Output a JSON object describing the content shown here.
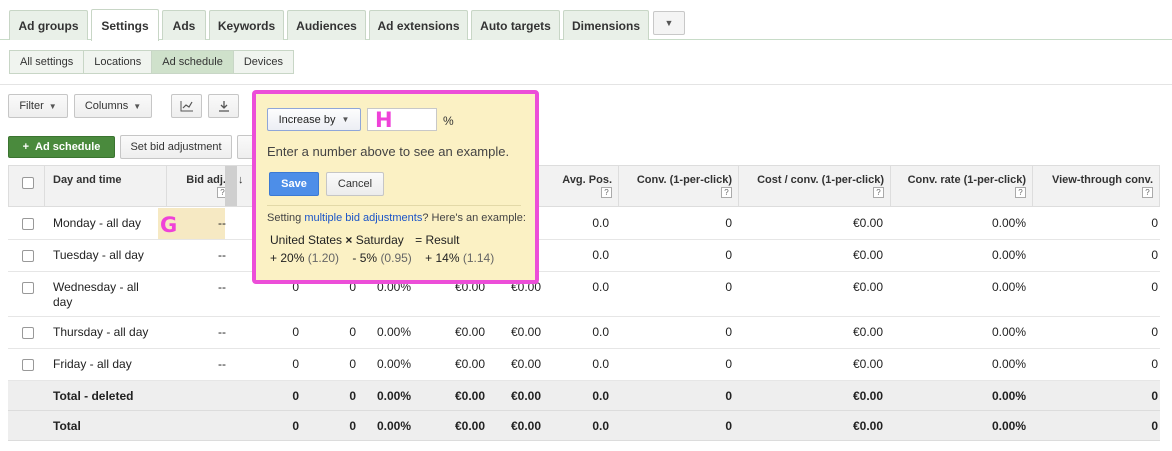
{
  "tabs": [
    "Ad groups",
    "Settings",
    "Ads",
    "Keywords",
    "Audiences",
    "Ad extensions",
    "Auto targets",
    "Dimensions"
  ],
  "tabs_active_index": 1,
  "subtabs": [
    "All settings",
    "Locations",
    "Ad schedule",
    "Devices"
  ],
  "subtabs_active_index": 2,
  "toolbar": {
    "filter": "Filter",
    "columns": "Columns"
  },
  "actions": {
    "add_schedule": "Ad schedule",
    "set_bid": "Set bid adjustment"
  },
  "table": {
    "headers": {
      "day_time": "Day and time",
      "bid_adj": "Bid adj.",
      "avg_pos": "Avg. Pos.",
      "conv": "Conv. (1-per-click)",
      "cost_conv": "Cost / conv. (1-per-click)",
      "conv_rate": "Conv. rate (1-per-click)",
      "view_through": "View-through conv."
    },
    "rows": [
      {
        "day": "Monday - all day",
        "bid": "--",
        "c1": "",
        "c2": "",
        "c3": "",
        "c4": "",
        "c5": "",
        "avg_pos": "0.0",
        "conv": "0",
        "cost_conv": "€0.00",
        "conv_rate": "0.00%",
        "view": "0"
      },
      {
        "day": "Tuesday - all day",
        "bid": "--",
        "c1": "",
        "c2": "",
        "c3": "",
        "c4": "",
        "c5": "",
        "avg_pos": "0.0",
        "conv": "0",
        "cost_conv": "€0.00",
        "conv_rate": "0.00%",
        "view": "0"
      },
      {
        "day": "Wednesday - all day",
        "bid": "--",
        "c1": "0",
        "c2": "0",
        "c3": "0.00%",
        "c4": "€0.00",
        "c5": "€0.00",
        "avg_pos": "0.0",
        "conv": "0",
        "cost_conv": "€0.00",
        "conv_rate": "0.00%",
        "view": "0"
      },
      {
        "day": "Thursday - all day",
        "bid": "--",
        "c1": "0",
        "c2": "0",
        "c3": "0.00%",
        "c4": "€0.00",
        "c5": "€0.00",
        "avg_pos": "0.0",
        "conv": "0",
        "cost_conv": "€0.00",
        "conv_rate": "0.00%",
        "view": "0"
      },
      {
        "day": "Friday - all day",
        "bid": "--",
        "c1": "0",
        "c2": "0",
        "c3": "0.00%",
        "c4": "€0.00",
        "c5": "€0.00",
        "avg_pos": "0.0",
        "conv": "0",
        "cost_conv": "€0.00",
        "conv_rate": "0.00%",
        "view": "0"
      }
    ],
    "totals": [
      {
        "day": "Total - deleted",
        "c1": "0",
        "c2": "0",
        "c3": "0.00%",
        "c4": "€0.00",
        "c5": "€0.00",
        "avg_pos": "0.0",
        "conv": "0",
        "cost_conv": "€0.00",
        "conv_rate": "0.00%",
        "view": "0"
      },
      {
        "day": "Total",
        "c1": "0",
        "c2": "0",
        "c3": "0.00%",
        "c4": "€0.00",
        "c5": "€0.00",
        "avg_pos": "0.0",
        "conv": "0",
        "cost_conv": "€0.00",
        "conv_rate": "0.00%",
        "view": "0"
      }
    ]
  },
  "popup": {
    "mode": "Increase by",
    "percent_value": "",
    "percent_sign": "%",
    "hint": "Enter a number above to see an example.",
    "save": "Save",
    "cancel": "Cancel",
    "multi_pre": "Setting ",
    "multi_link": "multiple bid adjustments",
    "multi_post": "? Here's an example:",
    "ex_country": "United States",
    "ex_times": "×",
    "ex_day": "Saturday",
    "ex_result": "= Result",
    "ex_a": "+ 20%",
    "ex_a_val": "(1.20)",
    "ex_b": "- 5%",
    "ex_b_val": "(0.95)",
    "ex_c": "+ 14%",
    "ex_c_val": "(1.14)"
  },
  "annotations": {
    "g": "G",
    "h": "H"
  },
  "colors": {
    "accent_green": "#4a8a3d",
    "highlight_pink": "#ec4ed8",
    "popup_bg": "#fbf1c4",
    "save_blue": "#4d8ee8"
  }
}
